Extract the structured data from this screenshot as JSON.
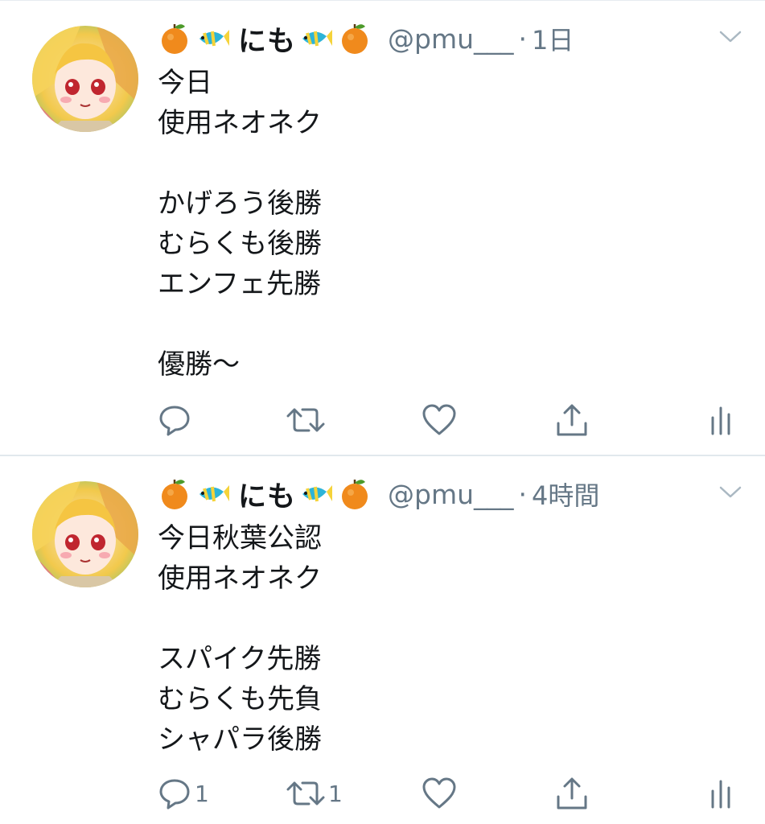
{
  "tweets": [
    {
      "display_name": "にも",
      "name_emoji": [
        "orange-emoji",
        "tropical-fish-emoji",
        "tropical-fish-emoji",
        "orange-emoji"
      ],
      "handle": "@pmu___",
      "separator": "·",
      "time": "1日",
      "body": "今日\n使用ネオネク\n\nかげろう後勝\nむらくも後勝\nエンフェ先勝\n\n優勝〜",
      "actions": {
        "reply_count": "",
        "retweet_count": "",
        "like_count": ""
      }
    },
    {
      "display_name": "にも",
      "name_emoji": [
        "orange-emoji",
        "tropical-fish-emoji",
        "tropical-fish-emoji",
        "orange-emoji"
      ],
      "handle": "@pmu___",
      "separator": "·",
      "time": "4時間",
      "body": "今日秋葉公認\n使用ネオネク\n\nスパイク先勝\nむらくも先負\nシャパラ後勝",
      "actions": {
        "reply_count": "1",
        "retweet_count": "1",
        "like_count": ""
      }
    }
  ],
  "colors": {
    "text": "#14171a",
    "secondary": "#657786",
    "divider": "#e1e8ed"
  },
  "icons": [
    "reply-icon",
    "retweet-icon",
    "like-icon",
    "share-icon",
    "analytics-icon",
    "caret-down-icon"
  ]
}
